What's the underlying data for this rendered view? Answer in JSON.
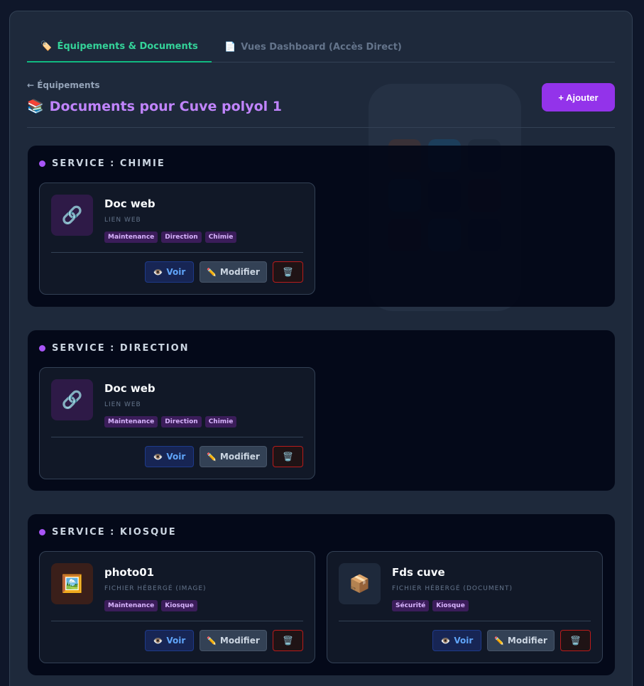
{
  "tabs": [
    {
      "icon": "🏷️",
      "label": "Équipements & Documents"
    },
    {
      "icon": "📄",
      "label": "Vues Dashboard (Accès Direct)"
    }
  ],
  "header": {
    "back_link": "← Équipements",
    "title_icon": "📚",
    "title": "Documents pour Cuve polyol 1",
    "add_button": "+ Ajouter"
  },
  "actions": {
    "view_icon": "👁️",
    "view": "Voir",
    "edit_icon": "✏️",
    "edit": "Modifier",
    "delete_icon": "🗑️"
  },
  "sections": [
    {
      "title": "SERVICE : CHIMIE",
      "docs": [
        {
          "icon": "🔗",
          "name": "Doc web",
          "type": "LIEN WEB",
          "tags": [
            "Maintenance",
            "Direction",
            "Chimie"
          ]
        }
      ]
    },
    {
      "title": "SERVICE : DIRECTION",
      "docs": [
        {
          "icon": "🔗",
          "name": "Doc web",
          "type": "LIEN WEB",
          "tags": [
            "Maintenance",
            "Direction",
            "Chimie"
          ]
        }
      ]
    },
    {
      "title": "SERVICE : KIOSQUE",
      "docs": [
        {
          "icon": "🖼️",
          "name": "photo01",
          "type": "FICHIER HÉBERGÉ (IMAGE)",
          "tags": [
            "Maintenance",
            "Kiosque"
          ]
        },
        {
          "icon": "📦",
          "name": "Fds cuve",
          "type": "FICHIER HÉBERGÉ (DOCUMENT)",
          "tags": [
            "Sécurité",
            "Kiosque"
          ]
        }
      ]
    }
  ]
}
